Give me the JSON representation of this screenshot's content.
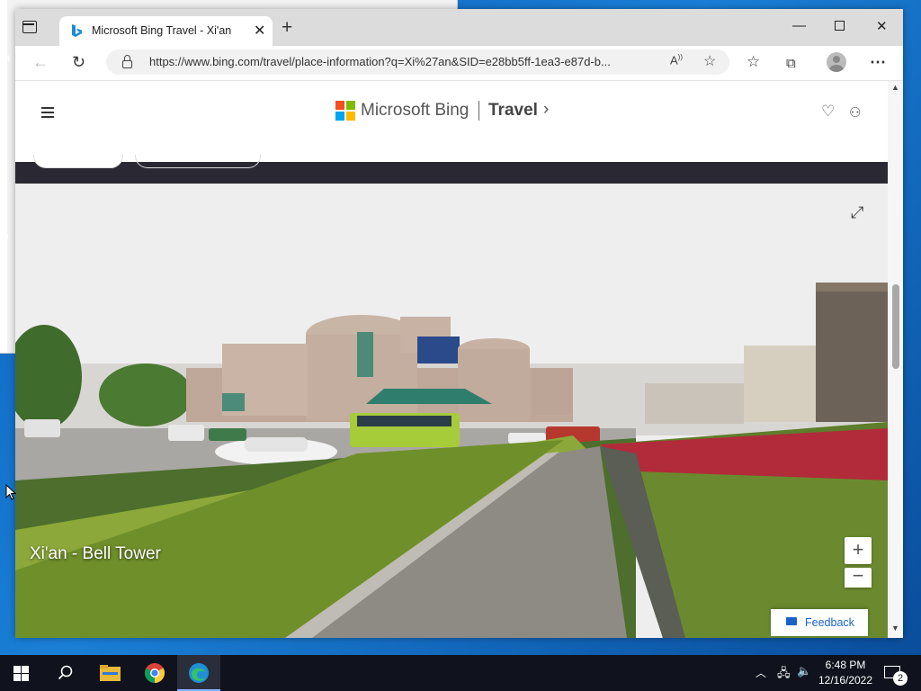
{
  "tab": {
    "title": "Microsoft Bing Travel - Xi'an"
  },
  "toolbar": {
    "url": "https://www.bing.com/travel/place-information?q=Xi%27an&SID=e28bb5ff-1ea3-e87d-b..."
  },
  "header": {
    "brand": "Microsoft Bing",
    "section": "Travel"
  },
  "hero": {
    "caption": "Xi'an - Bell Tower"
  },
  "feedback": {
    "label": "Feedback"
  },
  "taskbar": {
    "time": "6:48 PM",
    "date": "12/16/2022",
    "notifications": "2"
  },
  "colors": {
    "accent": "#1b62c8",
    "navstrip": "#2a2933",
    "taskbar": "#10131d"
  },
  "icons": [
    "tab-actions-icon",
    "bing-favicon",
    "close-icon",
    "plus-icon",
    "minimize-icon",
    "maximize-icon",
    "back-icon",
    "refresh-icon",
    "lock-icon",
    "read-aloud-icon",
    "add-favorite-icon",
    "favorites-icon",
    "collections-icon",
    "profile-icon",
    "more-icon",
    "hamburger-icon",
    "heart-icon",
    "account-icon",
    "expand-icon",
    "zoom-in-icon",
    "zoom-out-icon",
    "feedback-icon",
    "windows-icon",
    "search-icon",
    "file-explorer-icon",
    "chrome-icon",
    "edge-icon",
    "chevron-up-icon",
    "network-icon",
    "volume-icon",
    "notification-icon"
  ]
}
